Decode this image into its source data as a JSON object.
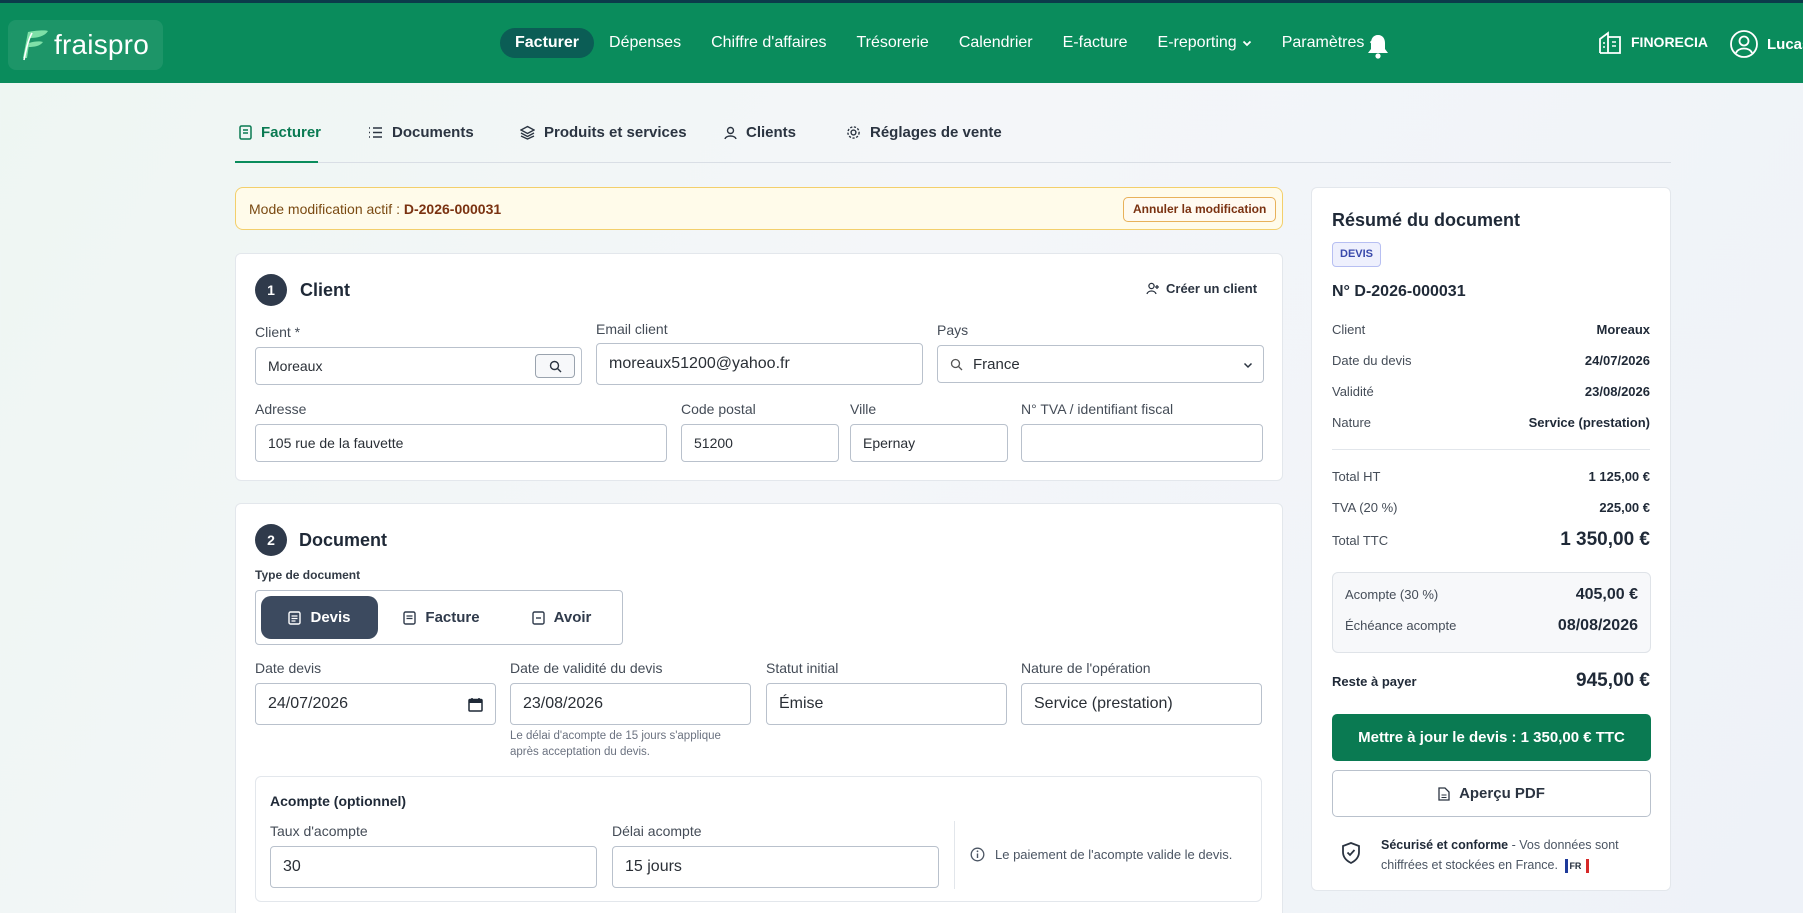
{
  "app": {
    "logo_text": "fraispro",
    "brand_color": "#0a8c5c"
  },
  "nav": {
    "items": [
      {
        "label": "Facturer",
        "active": true
      },
      {
        "label": "Dépenses"
      },
      {
        "label": "Chiffre d'affaires"
      },
      {
        "label": "Trésorerie"
      },
      {
        "label": "Calendrier"
      },
      {
        "label": "E-facture"
      },
      {
        "label": "E-reporting",
        "dropdown": true
      },
      {
        "label": "Paramètres",
        "dropdown": true
      }
    ],
    "org_name": "FINORECIA",
    "user_name": "Lucas"
  },
  "subtabs": [
    {
      "label": "Facturer",
      "icon": "receipt-icon",
      "active": true
    },
    {
      "label": "Documents",
      "icon": "list-icon"
    },
    {
      "label": "Produits et services",
      "icon": "layers-icon"
    },
    {
      "label": "Clients",
      "icon": "user-icon"
    },
    {
      "label": "Réglages de vente",
      "icon": "gear-icon"
    }
  ],
  "edit_banner": {
    "text": "Mode modification actif : ",
    "doc_number": "D-2026-000031",
    "cancel_label": "Annuler la modification"
  },
  "client_section": {
    "step": "1",
    "title": "Client",
    "create_label": "Créer un client",
    "client_label": "Client *",
    "client_value": "Moreaux",
    "email_label": "Email client",
    "email_value": "moreaux51200@yahoo.fr",
    "country_label": "Pays",
    "country_value": "France",
    "address_label": "Adresse",
    "address_value": "105 rue de la fauvette",
    "zip_label": "Code postal",
    "zip_value": "51200",
    "city_label": "Ville",
    "city_value": "Epernay",
    "vat_label": "N° TVA / identifiant fiscal",
    "vat_value": ""
  },
  "document_section": {
    "step": "2",
    "title": "Document",
    "type_label": "Type de document",
    "types": [
      {
        "label": "Devis",
        "active": true
      },
      {
        "label": "Facture"
      },
      {
        "label": "Avoir"
      }
    ],
    "date_label": "Date devis",
    "date_value": "24/07/2026",
    "validity_label": "Date de validité du devis",
    "validity_value": "23/08/2026",
    "validity_hint_1": "Le délai d'acompte de 15 jours s'applique",
    "validity_hint_2": "après acceptation du devis.",
    "status_label": "Statut initial",
    "status_value": "Émise",
    "nature_label": "Nature de l'opération",
    "nature_value": "Service (prestation)"
  },
  "deposit_section": {
    "title": "Acompte (optionnel)",
    "rate_label": "Taux d'acompte",
    "rate_value": "30",
    "delay_label": "Délai acompte",
    "delay_value": "15 jours",
    "info_text": "Le paiement de l'acompte valide le devis."
  },
  "summary": {
    "title": "Résumé du document",
    "badge": "DEVIS",
    "number": "N° D-2026-000031",
    "rows": [
      {
        "k": "Client",
        "v": "Moreaux"
      },
      {
        "k": "Date du devis",
        "v": "24/07/2026"
      },
      {
        "k": "Validité",
        "v": "23/08/2026"
      },
      {
        "k": "Nature",
        "v": "Service (prestation)"
      }
    ],
    "total_ht_label": "Total HT",
    "total_ht_value": "1 125,00 €",
    "tva_label": "TVA (20 %)",
    "tva_value": "225,00 €",
    "total_ttc_label": "Total TTC",
    "total_ttc_value": "1 350,00 €",
    "deposit_label": "Acompte (30 %)",
    "deposit_value": "405,00 €",
    "deposit_due_label": "Échéance acompte",
    "deposit_due_value": "08/08/2026",
    "remaining_label": "Reste à payer",
    "remaining_value": "945,00 €",
    "cta_label": "Mettre à jour le devis : 1 350,00 € TTC",
    "pdf_label": "Aperçu PDF",
    "secure_bold": "Sécurisé et conforme",
    "secure_text": " - Vos données sont chiffrées et stockées en France.",
    "flag_text": "FR"
  }
}
